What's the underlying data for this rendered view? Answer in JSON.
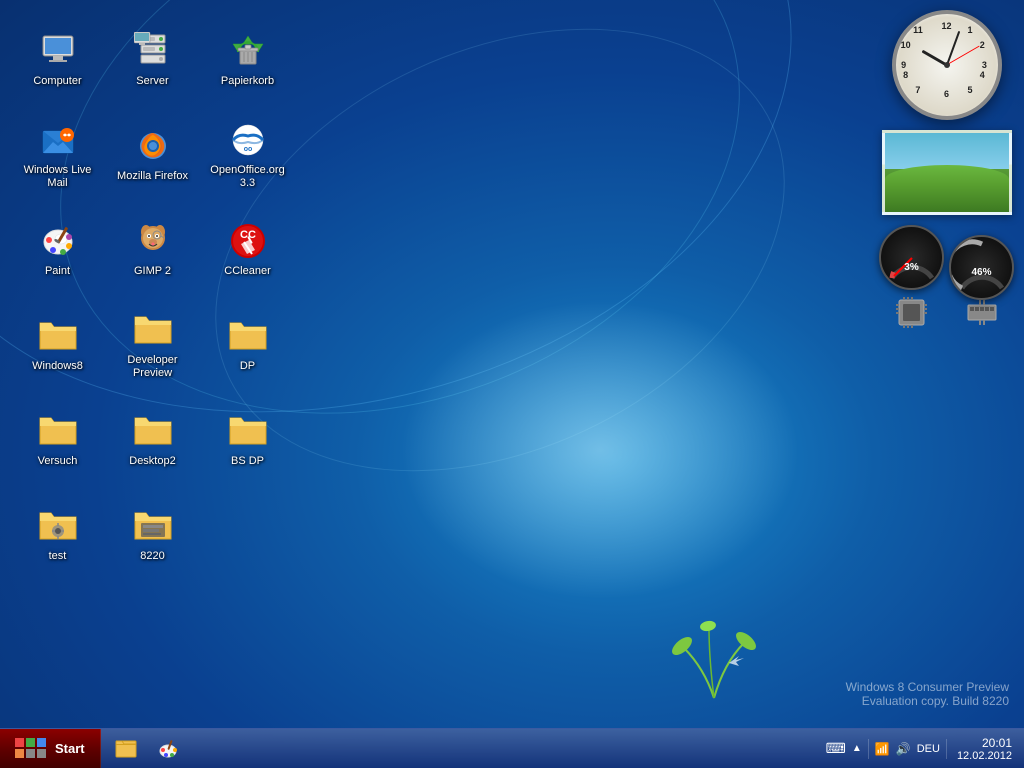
{
  "desktop": {
    "watermark_line1": "Windows 8 Consumer Preview",
    "watermark_line2": "Evaluation copy. Build 8220"
  },
  "icons": [
    {
      "id": "computer",
      "label": "Computer",
      "type": "computer",
      "col": 1,
      "row": 1
    },
    {
      "id": "server",
      "label": "Server",
      "type": "server",
      "col": 2,
      "row": 1
    },
    {
      "id": "papierkorb",
      "label": "Papierkorb",
      "type": "recycle",
      "col": 3,
      "row": 1
    },
    {
      "id": "windows-live-mail",
      "label": "Windows Live Mail",
      "type": "mail",
      "col": 1,
      "row": 2
    },
    {
      "id": "mozilla-firefox",
      "label": "Mozilla Firefox",
      "type": "firefox",
      "col": 2,
      "row": 2
    },
    {
      "id": "openoffice",
      "label": "OpenOffice.org 3.3",
      "type": "openoffice",
      "col": 3,
      "row": 2
    },
    {
      "id": "paint",
      "label": "Paint",
      "type": "paint",
      "col": 1,
      "row": 3
    },
    {
      "id": "gimp",
      "label": "GIMP 2",
      "type": "gimp",
      "col": 2,
      "row": 3
    },
    {
      "id": "ccleaner",
      "label": "CCleaner",
      "type": "ccleaner",
      "col": 3,
      "row": 3
    },
    {
      "id": "windows8",
      "label": "Windows8",
      "type": "folder",
      "col": 1,
      "row": 4
    },
    {
      "id": "developer-preview",
      "label": "Developer Preview",
      "type": "folder",
      "col": 2,
      "row": 4
    },
    {
      "id": "dp",
      "label": "DP",
      "type": "folder",
      "col": 3,
      "row": 4
    },
    {
      "id": "versuch",
      "label": "Versuch",
      "type": "folder",
      "col": 1,
      "row": 5
    },
    {
      "id": "desktop2",
      "label": "Desktop2",
      "type": "folder",
      "col": 2,
      "row": 5
    },
    {
      "id": "bs-dp",
      "label": "BS DP",
      "type": "folder",
      "col": 3,
      "row": 5
    },
    {
      "id": "test",
      "label": "test",
      "type": "folder-special",
      "col": 1,
      "row": 6
    },
    {
      "id": "8220",
      "label": "8220",
      "type": "folder-dark",
      "col": 2,
      "row": 6
    }
  ],
  "taskbar": {
    "start_label": "Start",
    "pinned_items": [
      {
        "id": "explorer",
        "icon": "🗂️",
        "label": "Explorer"
      },
      {
        "id": "paint-taskbar",
        "icon": "🎨",
        "label": "Paint"
      }
    ],
    "tray": {
      "keyboard_icon": "⌨",
      "network_icon": "📶",
      "volume_icon": "🔊",
      "language": "DEU",
      "time": "20:01",
      "date": "12.02.2012"
    }
  },
  "widgets": {
    "clock": {
      "hour_rotation": -60,
      "minute_rotation": 20,
      "second_rotation": 60
    },
    "cpu_percent": "3%",
    "memory_percent": "46%"
  }
}
